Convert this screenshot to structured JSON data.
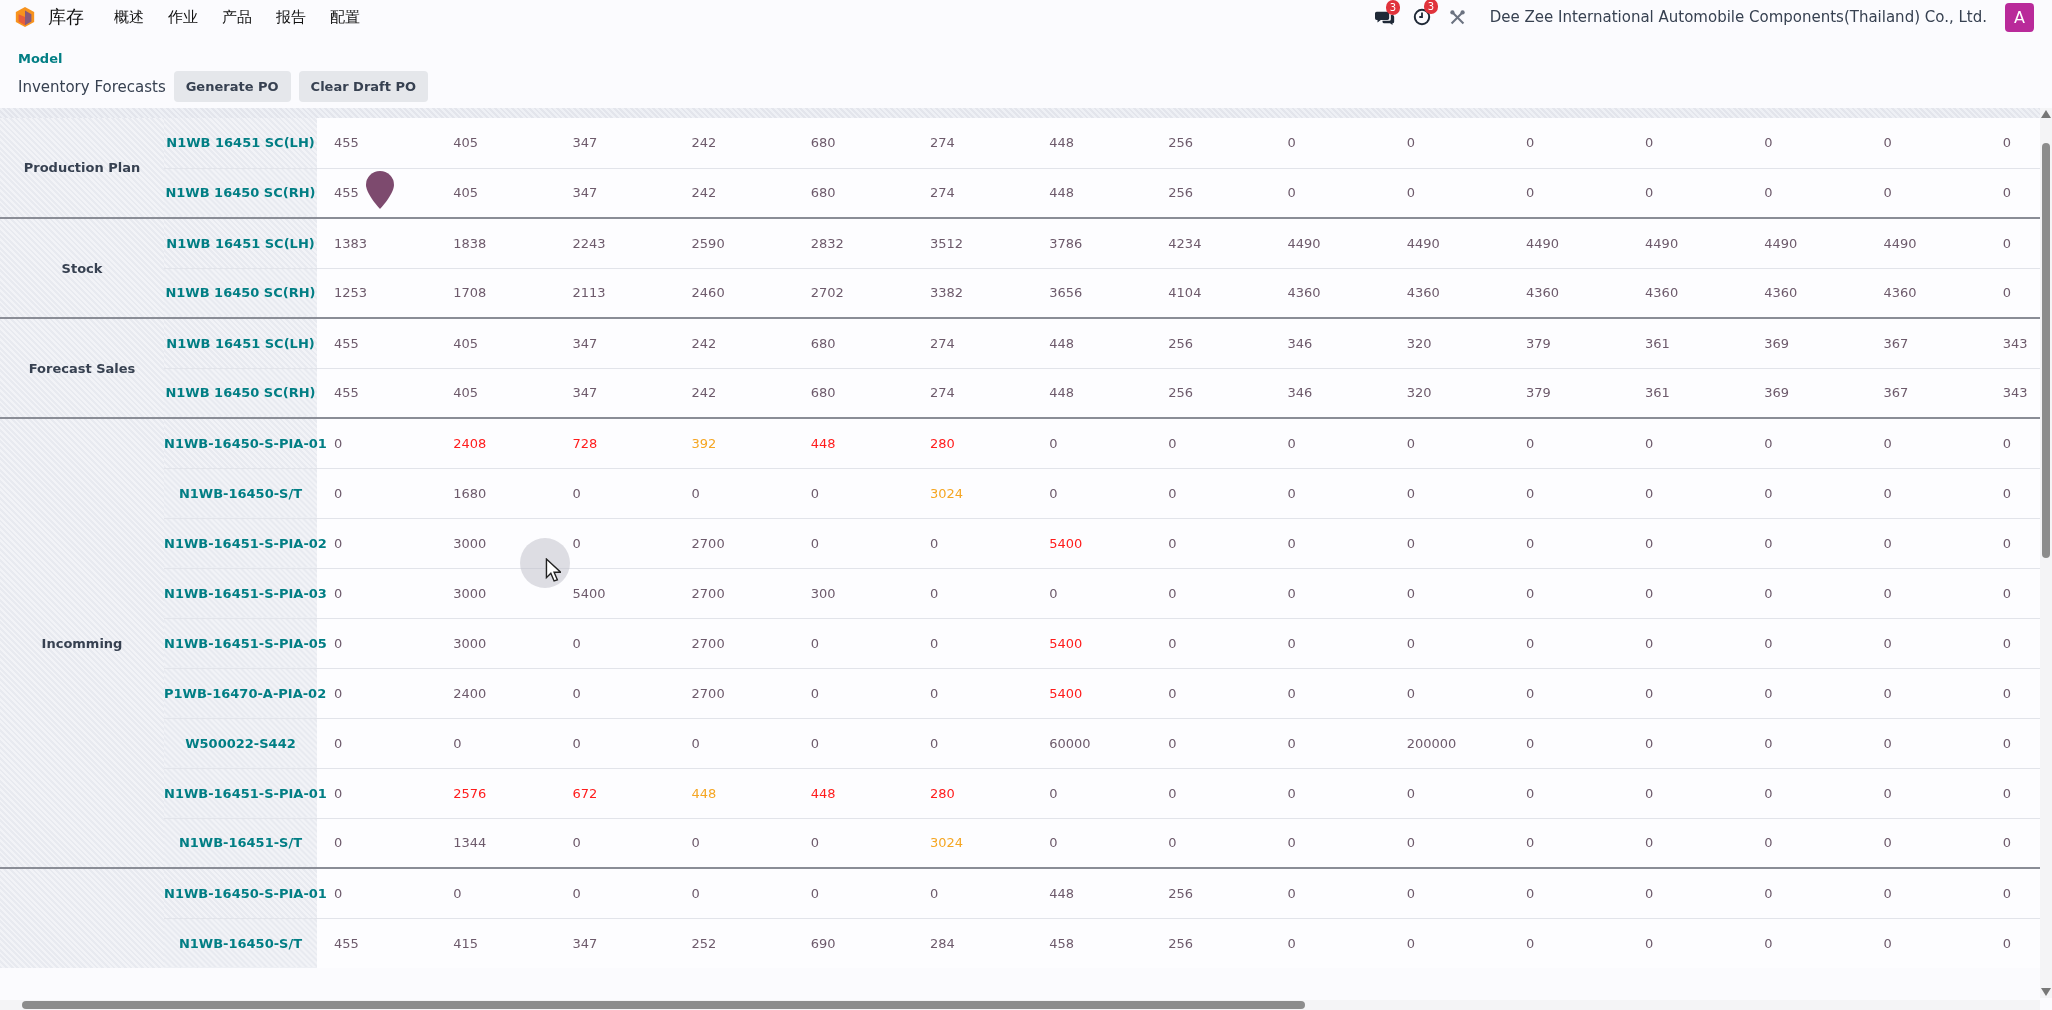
{
  "navbar": {
    "app_name": "库存",
    "menu": [
      "概述",
      "作业",
      "产品",
      "报告",
      "配置"
    ],
    "messages_badge": "3",
    "activities_badge": "3",
    "company": "Dee Zee International Automobile Components(Thailand) Co., Ltd.",
    "avatar_letter": "A"
  },
  "control_panel": {
    "breadcrumb": "Model",
    "title": "Inventory Forecasts",
    "buttons": [
      "Generate PO",
      "Clear Draft PO"
    ]
  },
  "table": {
    "groups": [
      {
        "label": "Production Plan",
        "rows": [
          {
            "product": "N1WB 16451 SC(LH)",
            "cells": [
              {
                "value": "455"
              },
              {
                "value": "405"
              },
              {
                "value": "347"
              },
              {
                "value": "242"
              },
              {
                "value": "680"
              },
              {
                "value": "274"
              },
              {
                "value": "448"
              },
              {
                "value": "256"
              },
              {
                "value": "0"
              },
              {
                "value": "0"
              },
              {
                "value": "0"
              },
              {
                "value": "0"
              },
              {
                "value": "0"
              },
              {
                "value": "0"
              },
              {
                "value": "0"
              }
            ]
          },
          {
            "product": "N1WB 16450 SC(RH)",
            "cells": [
              {
                "value": "455"
              },
              {
                "value": "405"
              },
              {
                "value": "347"
              },
              {
                "value": "242"
              },
              {
                "value": "680"
              },
              {
                "value": "274"
              },
              {
                "value": "448"
              },
              {
                "value": "256"
              },
              {
                "value": "0"
              },
              {
                "value": "0"
              },
              {
                "value": "0"
              },
              {
                "value": "0"
              },
              {
                "value": "0"
              },
              {
                "value": "0"
              },
              {
                "value": "0"
              }
            ]
          }
        ]
      },
      {
        "label": "Stock",
        "rows": [
          {
            "product": "N1WB 16451 SC(LH)",
            "cells": [
              {
                "value": "1383"
              },
              {
                "value": "1838"
              },
              {
                "value": "2243"
              },
              {
                "value": "2590"
              },
              {
                "value": "2832"
              },
              {
                "value": "3512"
              },
              {
                "value": "3786"
              },
              {
                "value": "4234"
              },
              {
                "value": "4490"
              },
              {
                "value": "4490"
              },
              {
                "value": "4490"
              },
              {
                "value": "4490"
              },
              {
                "value": "4490"
              },
              {
                "value": "4490"
              },
              {
                "value": "0"
              }
            ]
          },
          {
            "product": "N1WB 16450 SC(RH)",
            "cells": [
              {
                "value": "1253"
              },
              {
                "value": "1708"
              },
              {
                "value": "2113"
              },
              {
                "value": "2460"
              },
              {
                "value": "2702"
              },
              {
                "value": "3382"
              },
              {
                "value": "3656"
              },
              {
                "value": "4104"
              },
              {
                "value": "4360"
              },
              {
                "value": "4360"
              },
              {
                "value": "4360"
              },
              {
                "value": "4360"
              },
              {
                "value": "4360"
              },
              {
                "value": "4360"
              },
              {
                "value": "0"
              }
            ]
          }
        ]
      },
      {
        "label": "Forecast Sales",
        "rows": [
          {
            "product": "N1WB 16451 SC(LH)",
            "cells": [
              {
                "value": "455"
              },
              {
                "value": "405"
              },
              {
                "value": "347"
              },
              {
                "value": "242"
              },
              {
                "value": "680"
              },
              {
                "value": "274"
              },
              {
                "value": "448"
              },
              {
                "value": "256"
              },
              {
                "value": "346"
              },
              {
                "value": "320"
              },
              {
                "value": "379"
              },
              {
                "value": "361"
              },
              {
                "value": "369"
              },
              {
                "value": "367"
              },
              {
                "value": "343"
              }
            ]
          },
          {
            "product": "N1WB 16450 SC(RH)",
            "cells": [
              {
                "value": "455"
              },
              {
                "value": "405"
              },
              {
                "value": "347"
              },
              {
                "value": "242"
              },
              {
                "value": "680"
              },
              {
                "value": "274"
              },
              {
                "value": "448"
              },
              {
                "value": "256"
              },
              {
                "value": "346"
              },
              {
                "value": "320"
              },
              {
                "value": "379"
              },
              {
                "value": "361"
              },
              {
                "value": "369"
              },
              {
                "value": "367"
              },
              {
                "value": "343"
              }
            ]
          }
        ]
      },
      {
        "label": "Incomming",
        "rows": [
          {
            "product": "N1WB-16450-S-PIA-01",
            "cells": [
              {
                "value": "0"
              },
              {
                "value": "2408",
                "color": "#ff1c1c"
              },
              {
                "value": "728",
                "color": "#ff1c1c"
              },
              {
                "value": "392",
                "color": "#f5a623"
              },
              {
                "value": "448",
                "color": "#ff1c1c"
              },
              {
                "value": "280",
                "color": "#ff1c1c"
              },
              {
                "value": "0"
              },
              {
                "value": "0"
              },
              {
                "value": "0"
              },
              {
                "value": "0"
              },
              {
                "value": "0"
              },
              {
                "value": "0"
              },
              {
                "value": "0"
              },
              {
                "value": "0"
              },
              {
                "value": "0"
              }
            ]
          },
          {
            "product": "N1WB-16450-S/T",
            "cells": [
              {
                "value": "0"
              },
              {
                "value": "1680"
              },
              {
                "value": "0"
              },
              {
                "value": "0"
              },
              {
                "value": "0"
              },
              {
                "value": "3024",
                "color": "#f5a623"
              },
              {
                "value": "0"
              },
              {
                "value": "0"
              },
              {
                "value": "0"
              },
              {
                "value": "0"
              },
              {
                "value": "0"
              },
              {
                "value": "0"
              },
              {
                "value": "0"
              },
              {
                "value": "0"
              },
              {
                "value": "0"
              }
            ]
          },
          {
            "product": "N1WB-16451-S-PIA-02",
            "cells": [
              {
                "value": "0"
              },
              {
                "value": "3000"
              },
              {
                "value": "0"
              },
              {
                "value": "2700"
              },
              {
                "value": "0"
              },
              {
                "value": "0"
              },
              {
                "value": "5400",
                "color": "#ff1c1c"
              },
              {
                "value": "0"
              },
              {
                "value": "0"
              },
              {
                "value": "0"
              },
              {
                "value": "0"
              },
              {
                "value": "0"
              },
              {
                "value": "0"
              },
              {
                "value": "0"
              },
              {
                "value": "0"
              }
            ]
          },
          {
            "product": "N1WB-16451-S-PIA-03",
            "cells": [
              {
                "value": "0"
              },
              {
                "value": "3000"
              },
              {
                "value": "5400"
              },
              {
                "value": "2700"
              },
              {
                "value": "300"
              },
              {
                "value": "0"
              },
              {
                "value": "0"
              },
              {
                "value": "0"
              },
              {
                "value": "0"
              },
              {
                "value": "0"
              },
              {
                "value": "0"
              },
              {
                "value": "0"
              },
              {
                "value": "0"
              },
              {
                "value": "0"
              },
              {
                "value": "0"
              }
            ]
          },
          {
            "product": "N1WB-16451-S-PIA-05",
            "cells": [
              {
                "value": "0"
              },
              {
                "value": "3000"
              },
              {
                "value": "0"
              },
              {
                "value": "2700"
              },
              {
                "value": "0"
              },
              {
                "value": "0"
              },
              {
                "value": "5400",
                "color": "#ff1c1c"
              },
              {
                "value": "0"
              },
              {
                "value": "0"
              },
              {
                "value": "0"
              },
              {
                "value": "0"
              },
              {
                "value": "0"
              },
              {
                "value": "0"
              },
              {
                "value": "0"
              },
              {
                "value": "0"
              }
            ]
          },
          {
            "product": "P1WB-16470-A-PIA-02",
            "cells": [
              {
                "value": "0"
              },
              {
                "value": "2400"
              },
              {
                "value": "0"
              },
              {
                "value": "2700"
              },
              {
                "value": "0"
              },
              {
                "value": "0"
              },
              {
                "value": "5400",
                "color": "#ff1c1c"
              },
              {
                "value": "0"
              },
              {
                "value": "0"
              },
              {
                "value": "0"
              },
              {
                "value": "0"
              },
              {
                "value": "0"
              },
              {
                "value": "0"
              },
              {
                "value": "0"
              },
              {
                "value": "0"
              }
            ]
          },
          {
            "product": "W500022-S442",
            "cells": [
              {
                "value": "0"
              },
              {
                "value": "0"
              },
              {
                "value": "0"
              },
              {
                "value": "0"
              },
              {
                "value": "0"
              },
              {
                "value": "0"
              },
              {
                "value": "60000"
              },
              {
                "value": "0"
              },
              {
                "value": "0"
              },
              {
                "value": "200000"
              },
              {
                "value": "0"
              },
              {
                "value": "0"
              },
              {
                "value": "0"
              },
              {
                "value": "0"
              },
              {
                "value": "0"
              }
            ]
          },
          {
            "product": "N1WB-16451-S-PIA-01",
            "cells": [
              {
                "value": "0"
              },
              {
                "value": "2576",
                "color": "#ff1c1c"
              },
              {
                "value": "672",
                "color": "#ff1c1c"
              },
              {
                "value": "448",
                "color": "#f5a623"
              },
              {
                "value": "448",
                "color": "#ff1c1c"
              },
              {
                "value": "280",
                "color": "#ff1c1c"
              },
              {
                "value": "0"
              },
              {
                "value": "0"
              },
              {
                "value": "0"
              },
              {
                "value": "0"
              },
              {
                "value": "0"
              },
              {
                "value": "0"
              },
              {
                "value": "0"
              },
              {
                "value": "0"
              },
              {
                "value": "0"
              }
            ]
          },
          {
            "product": "N1WB-16451-S/T",
            "cells": [
              {
                "value": "0"
              },
              {
                "value": "1344"
              },
              {
                "value": "0"
              },
              {
                "value": "0"
              },
              {
                "value": "0"
              },
              {
                "value": "3024",
                "color": "#f5a623"
              },
              {
                "value": "0"
              },
              {
                "value": "0"
              },
              {
                "value": "0"
              },
              {
                "value": "0"
              },
              {
                "value": "0"
              },
              {
                "value": "0"
              },
              {
                "value": "0"
              },
              {
                "value": "0"
              },
              {
                "value": "0"
              }
            ]
          }
        ]
      },
      {
        "rows": [
          {
            "product": "N1WB-16450-S-PIA-01",
            "cells": [
              {
                "value": "0"
              },
              {
                "value": "0"
              },
              {
                "value": "0"
              },
              {
                "value": "0"
              },
              {
                "value": "0"
              },
              {
                "value": "0"
              },
              {
                "value": "448"
              },
              {
                "value": "256"
              },
              {
                "value": "0"
              },
              {
                "value": "0"
              },
              {
                "value": "0"
              },
              {
                "value": "0"
              },
              {
                "value": "0"
              },
              {
                "value": "0"
              },
              {
                "value": "0"
              }
            ]
          },
          {
            "product": "N1WB-16450-S/T",
            "cells": [
              {
                "value": "455"
              },
              {
                "value": "415"
              },
              {
                "value": "347"
              },
              {
                "value": "252"
              },
              {
                "value": "690"
              },
              {
                "value": "284"
              },
              {
                "value": "458"
              },
              {
                "value": "256"
              },
              {
                "value": "0"
              },
              {
                "value": "0"
              },
              {
                "value": "0"
              },
              {
                "value": "0"
              },
              {
                "value": "0"
              },
              {
                "value": "0"
              },
              {
                "value": "0"
              }
            ]
          }
        ]
      }
    ]
  }
}
